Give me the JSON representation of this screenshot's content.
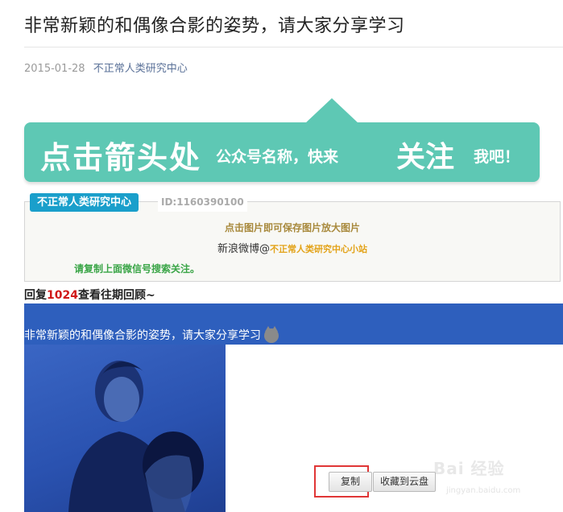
{
  "article": {
    "title": "非常新颖的和偶像合影的姿势，请大家分享学习",
    "date": "2015-01-28",
    "author": "不正常人类研究中心"
  },
  "banner": {
    "big_text": "点击箭头处",
    "small_text": "公众号名称，快来",
    "follow_text": "关注",
    "tail_text": "我吧！",
    "color": "#5ec8b4"
  },
  "card": {
    "tag": "不正常人类研究中心",
    "id_text": "ID:1160390100",
    "line1": "点击图片即可保存图片放大图片",
    "line2_prefix": "新浪微博@",
    "line2_name": "不正常人类研究中心小站",
    "line3": "请复制上面微信号搜索关注。"
  },
  "reply": {
    "prefix": "回复",
    "number": "1024",
    "suffix": "查看往期回顾~"
  },
  "blue_section": {
    "caption": "非常新颖的和偶像合影的姿势，请大家分享学习",
    "color": "#2e5fbd"
  },
  "buttons": {
    "copy": "复制",
    "save_to_cloud": "收藏到云盘"
  },
  "watermark": {
    "brand": "Bai 经验",
    "url": "jingyan.baidu.com"
  }
}
